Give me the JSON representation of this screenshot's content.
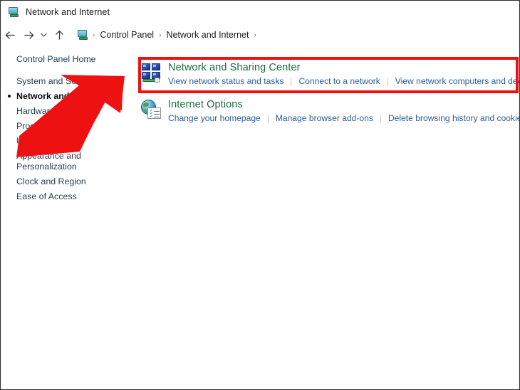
{
  "window": {
    "title": "Network and Internet",
    "title_icon": "network-monitor-icon"
  },
  "navigation": {
    "back_icon": "back-arrow-icon",
    "forward_icon": "forward-arrow-icon",
    "recent_icon": "chevron-down-icon",
    "up_icon": "up-arrow-icon",
    "breadcrumb_icon": "network-monitor-icon",
    "breadcrumb": [
      {
        "label": "Control Panel"
      },
      {
        "label": "Network and Internet"
      }
    ],
    "separator": "›"
  },
  "sidebar": {
    "home_label": "Control Panel Home",
    "items": [
      {
        "label": "System and Security",
        "current": false
      },
      {
        "label": "Network and Internet",
        "current": true
      },
      {
        "label": "Hardware and Sound",
        "current": false
      },
      {
        "label": "Programs",
        "current": false
      },
      {
        "label": "User Accounts",
        "current": false
      },
      {
        "label": "Appearance and Personalization",
        "current": false
      },
      {
        "label": "Clock and Region",
        "current": false
      },
      {
        "label": "Ease of Access",
        "current": false
      }
    ]
  },
  "main": {
    "categories": [
      {
        "icon": "network-sharing-center-icon",
        "title": "Network and Sharing Center",
        "links": [
          "View network status and tasks",
          "Connect to a network",
          "View network computers and devices"
        ]
      },
      {
        "icon": "internet-options-icon",
        "title": "Internet Options",
        "links": [
          "Change your homepage",
          "Manage browser add-ons",
          "Delete browsing history and cookies"
        ]
      }
    ]
  },
  "annotations": {
    "highlight_color": "#ee1111",
    "arrow_color": "#ee1111",
    "highlight_target": "Network and Sharing Center",
    "arrow_name": "red-pointer-arrow"
  },
  "colors": {
    "category_title": "#1c6b41",
    "link": "#2a5f9e",
    "sidebar_link": "#2b3d52",
    "text": "#1b1b1b",
    "window_border": "#2b2b2b"
  }
}
